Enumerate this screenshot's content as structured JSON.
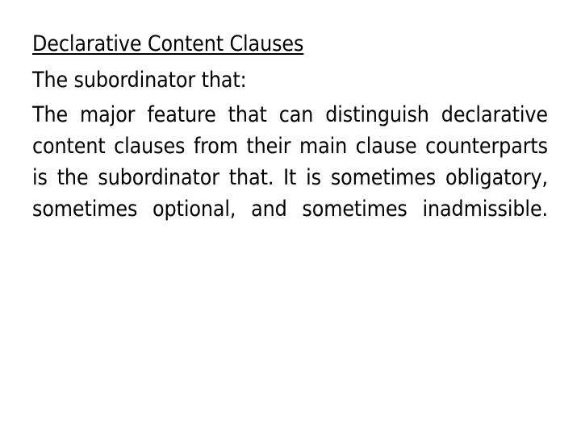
{
  "slide": {
    "background_color": "#ffffff",
    "text_color": "#000000",
    "title": "Declarative Content Clauses",
    "subheading": "The subordinator that:",
    "paragraph": "The major feature that can distinguish declarative content clauses from their main clause counterparts is the subordinator that.  It is sometimes obligatory, sometimes optional, and sometimes inadmissible.",
    "paragraph_lines": [
      "The major feature that can distinguish",
      "declarative content clauses from their main",
      "clause counterparts is the subordinator that.  It",
      "is sometimes obligatory, sometimes optional,",
      "and sometimes inadmissible."
    ]
  }
}
